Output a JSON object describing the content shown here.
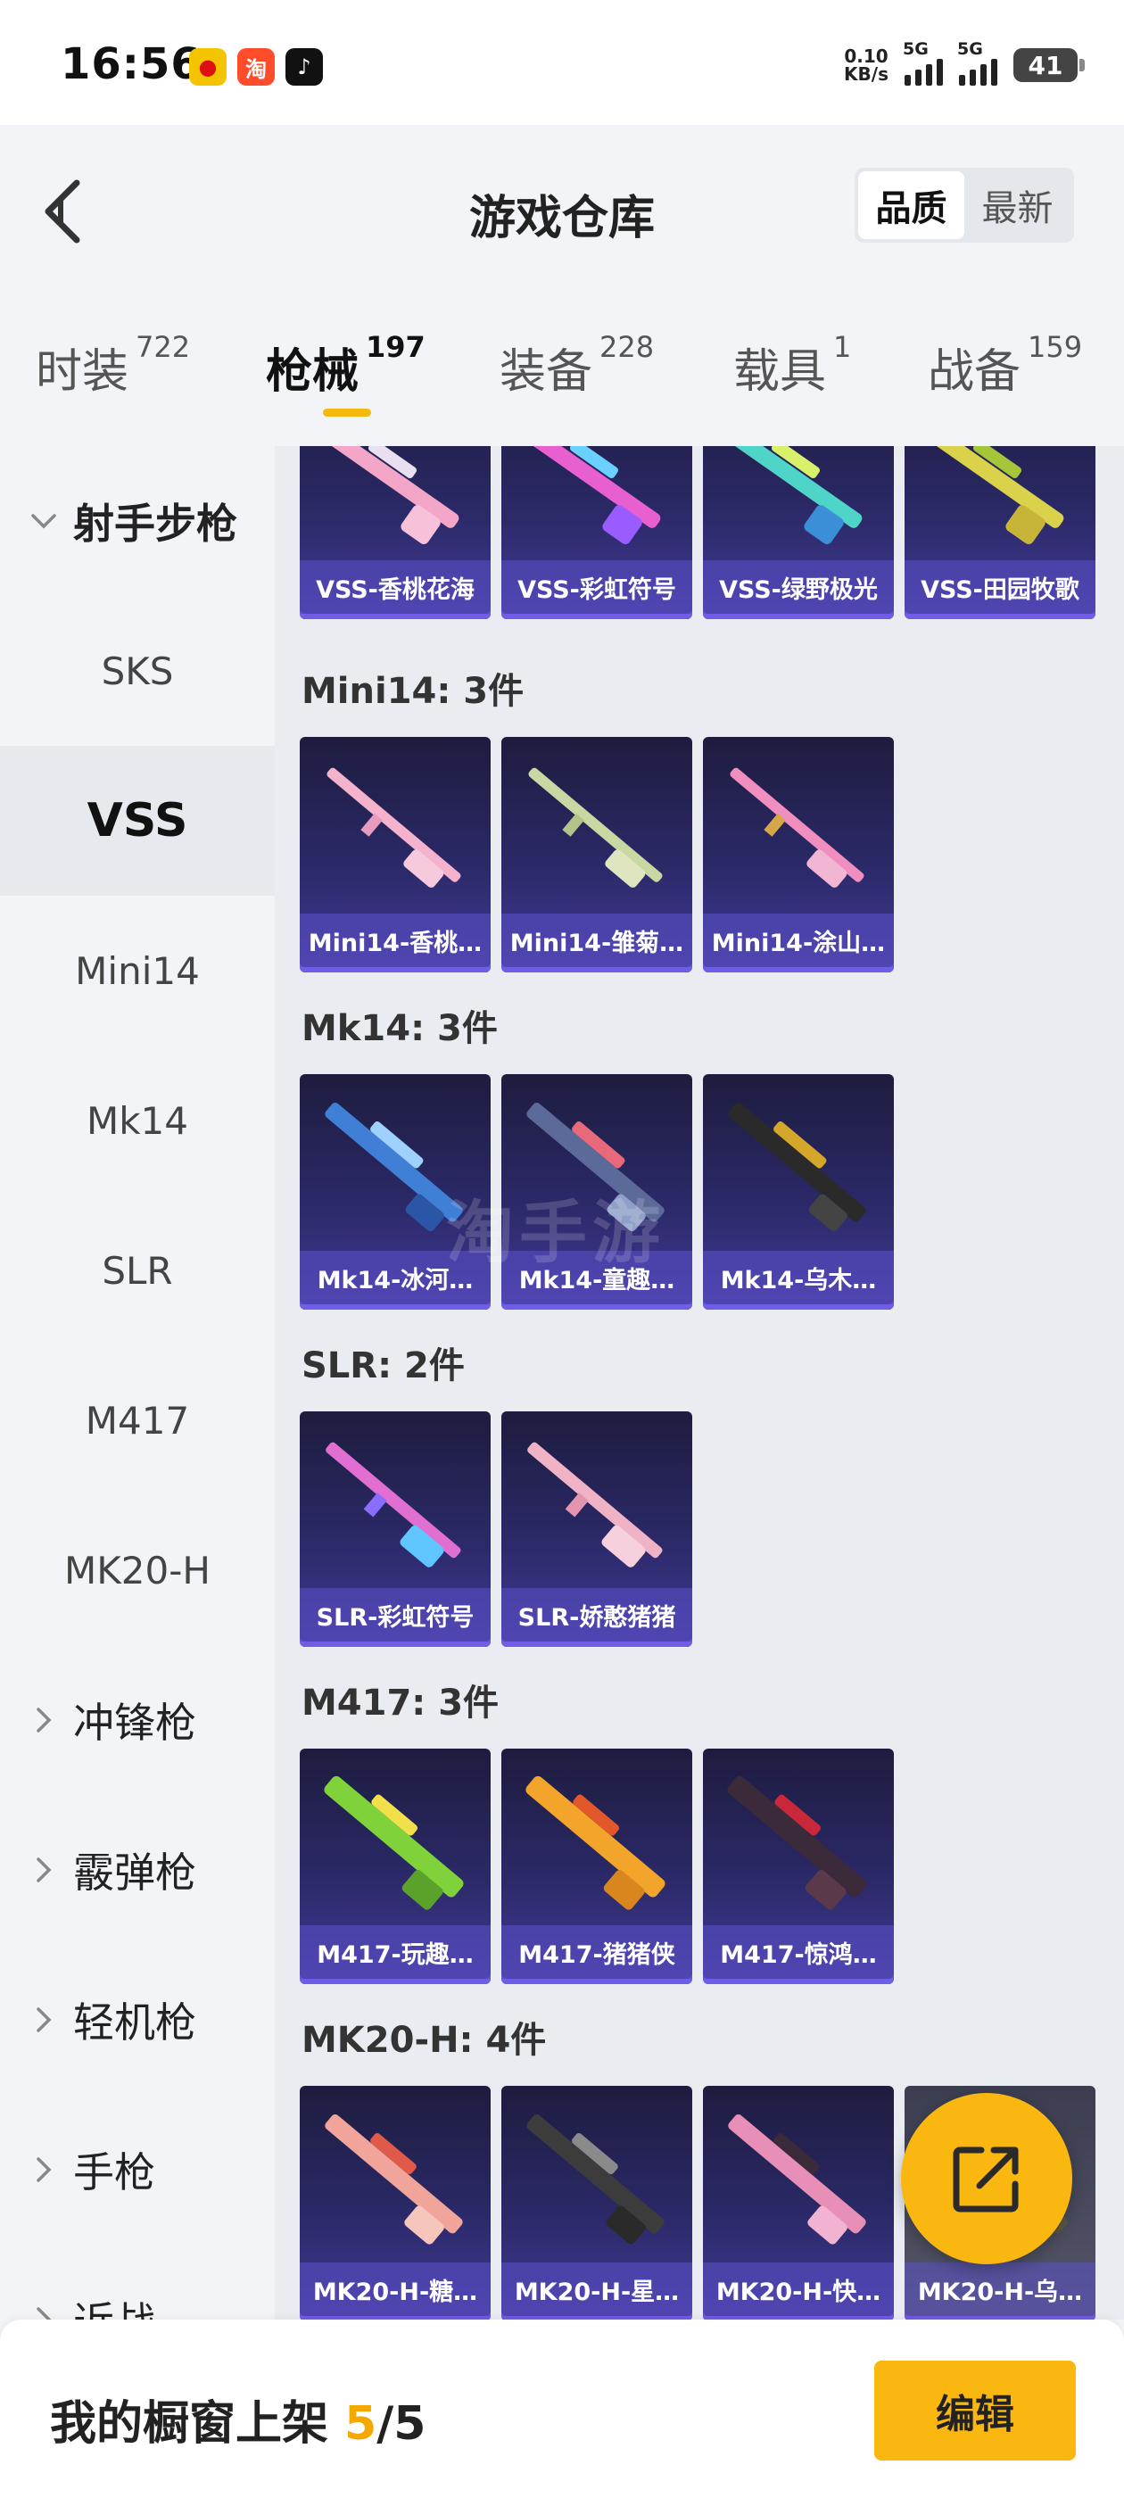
{
  "status_bar": {
    "time": "16:56",
    "net_speed_value": "0.10",
    "net_speed_unit": "KB/s",
    "signal1_label": "5G",
    "signal2_label": "5G",
    "battery": "41",
    "apps": [
      "weibo-icon",
      "taobao-icon",
      "douyin-icon"
    ]
  },
  "header": {
    "title": "游戏仓库",
    "sort_options": [
      "品质",
      "最新"
    ],
    "sort_selected": "品质"
  },
  "tabs": [
    {
      "label": "时装",
      "count": "722"
    },
    {
      "label": "枪械",
      "count": "197",
      "active": true
    },
    {
      "label": "装备",
      "count": "228"
    },
    {
      "label": "载具",
      "count": "1"
    },
    {
      "label": "战备",
      "count": "159"
    }
  ],
  "sidebar": {
    "group_rifle": "射手步枪",
    "items": [
      "SKS",
      "VSS",
      "Mini14",
      "Mk14",
      "SLR",
      "M417",
      "MK20-H"
    ],
    "active_item": "VSS",
    "groups_collapsed": [
      "冲锋枪",
      "霰弹枪",
      "轻机枪",
      "手枪",
      "近战"
    ]
  },
  "sections": {
    "vss": {
      "title": "",
      "items": [
        "VSS-香桃花海",
        "VSS-彩虹符号",
        "VSS-绿野极光",
        "VSS-田园牧歌"
      ]
    },
    "mini14": {
      "title": "Mini14: 3件",
      "items": [
        "Mini14-香桃…",
        "Mini14-雏菊…",
        "Mini14-涂山…"
      ]
    },
    "mk14": {
      "title": "Mk14: 3件",
      "items": [
        "Mk14-冰河…",
        "Mk14-童趣…",
        "Mk14-乌木…"
      ]
    },
    "slr": {
      "title": "SLR: 2件",
      "items": [
        "SLR-彩虹符号",
        "SLR-娇憨猪猪"
      ]
    },
    "m417": {
      "title": "M417: 3件",
      "items": [
        "M417-玩趣…",
        "M417-猪猪侠",
        "M417-惊鸿…"
      ]
    },
    "mk20h": {
      "title": "MK20-H: 4件",
      "items": [
        "MK20-H-糖…",
        "MK20-H-星…",
        "MK20-H-快…",
        "MK20-H-乌…"
      ]
    }
  },
  "watermark": "淘手游",
  "bottom": {
    "shelf_prefix": "我的橱窗上架 ",
    "shelf_current": "5",
    "shelf_sep_total": "/5",
    "edit_label": "编辑"
  },
  "colors": {
    "accent": "#f9b70f",
    "card_top": "#1d1c3e",
    "card_bottom": "#433a98"
  }
}
